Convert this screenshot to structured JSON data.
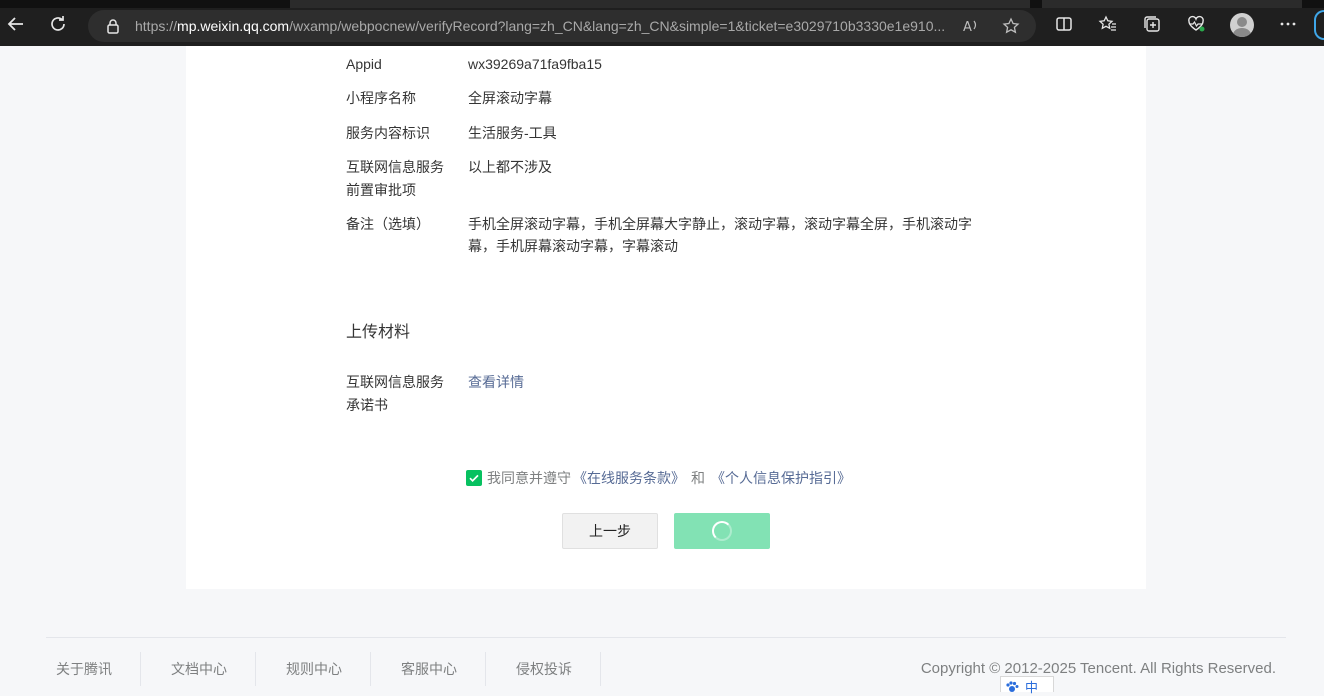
{
  "browser": {
    "url_prefix": "https://",
    "url_host": "mp.weixin.qq.com",
    "url_path": "/wxamp/webpocnew/verifyRecord?lang=zh_CN&lang=zh_CN&simple=1&ticket=e3029710b3330e1e910..."
  },
  "details": [
    {
      "label": "Appid",
      "value": "wx39269a71fa9fba15"
    },
    {
      "label": "小程序名称",
      "value": "全屏滚动字幕"
    },
    {
      "label": "服务内容标识",
      "value": "生活服务-工具"
    },
    {
      "label": "互联网信息服务前置审批项",
      "value": "以上都不涉及"
    },
    {
      "label": "备注（选填）",
      "value": "手机全屏滚动字幕，手机全屏幕大字静止，滚动字幕，滚动字幕全屏，手机滚动字幕，手机屏幕滚动字幕，字幕滚动"
    }
  ],
  "upload": {
    "title": "上传材料",
    "label": "互联网信息服务承诺书",
    "link": "查看详情"
  },
  "agreement": {
    "checked": true,
    "text": "我同意并遵守",
    "terms_link": "《在线服务条款》",
    "and": "和",
    "privacy_link": "《个人信息保护指引》"
  },
  "buttons": {
    "prev": "上一步"
  },
  "footer": {
    "links": [
      "关于腾讯",
      "文档中心",
      "规则中心",
      "客服中心",
      "侵权投诉"
    ],
    "copyright": "Copyright © 2012-2025 Tencent. All Rights Reserved."
  },
  "ime": {
    "label": "中"
  },
  "colors": {
    "accent": "#07c160",
    "link": "#576b95",
    "loading_button": "#82e2b4"
  }
}
